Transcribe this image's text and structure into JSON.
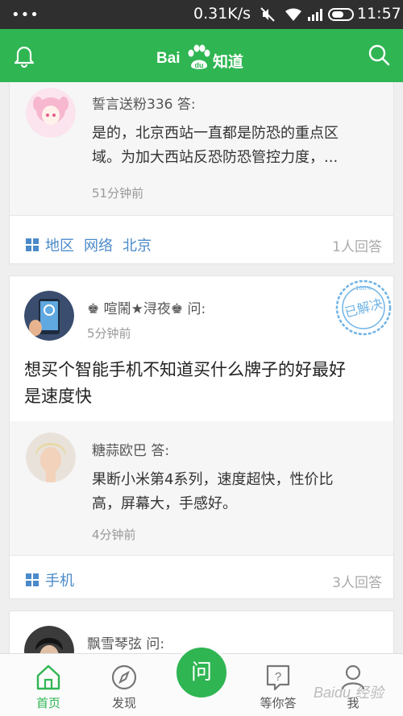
{
  "status_bar": {
    "dots": "•••",
    "speed": "0.31K/s",
    "time": "11:57"
  },
  "header": {
    "logo_bai": "Bai",
    "logo_du": "du",
    "logo_zhidao": "知道"
  },
  "feed": {
    "card1": {
      "answerer": "誓言送粉336 答:",
      "answer_line1": "是的，北京西站一直都是防恐的重点区",
      "answer_line2": "域。为加大西站反恐防恐管控力度，...",
      "time": "51分钟前",
      "tags": [
        "地区",
        "网络",
        "北京"
      ],
      "count": "1人回答"
    },
    "card2": {
      "asker": "♚ 喧鬧★浔夜♚ 问:",
      "asked_time": "5分钟前",
      "question_line1": "想买个智能手机不知道买什么牌子的好最好",
      "question_line2": "是速度快",
      "stamp_text": "已解决",
      "stamp_pct": "100%",
      "answerer": "糖蒜欧巴 答:",
      "answer_line1": "果断小米第4系列，速度超快，性价比",
      "answer_line2": "高，屏幕大，手感好。",
      "time": "4分钟前",
      "tags": [
        "手机"
      ],
      "count": "3人回答"
    },
    "card3": {
      "asker": "飘雪琴弦 问:"
    }
  },
  "bottom_nav": {
    "items": [
      {
        "label": "首页",
        "icon": "home-icon",
        "active": true
      },
      {
        "label": "发现",
        "icon": "compass-icon",
        "active": false
      },
      {
        "label": "等你答",
        "icon": "question-doc-icon",
        "active": false
      },
      {
        "label": "我",
        "icon": "person-icon",
        "active": false
      }
    ],
    "ask_label": "问",
    "watermark": "Baidu 经验"
  },
  "colors": {
    "brand_green": "#2fb552",
    "tag_blue": "#4b8ac9",
    "stamp_blue": "#6fb3e6"
  }
}
